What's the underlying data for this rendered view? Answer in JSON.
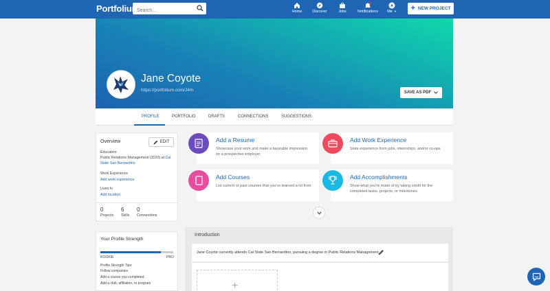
{
  "nav": {
    "logo": "Portfolium",
    "search_placeholder": "Search...",
    "items": [
      {
        "label": "Home",
        "icon": "home-icon"
      },
      {
        "label": "Discover",
        "icon": "compass-icon"
      },
      {
        "label": "Jobs",
        "icon": "briefcase-icon"
      },
      {
        "label": "Notifications",
        "icon": "bell-icon"
      },
      {
        "label": "Me",
        "icon": "avatar-icon"
      }
    ],
    "new_project": "NEW PROJECT"
  },
  "profile": {
    "name": "Jane Coyote",
    "url": "https://portfolium.com/J4m",
    "save_pdf": "SAVE AS PDF"
  },
  "tabs": [
    "PROFILE",
    "PORTFOLIO",
    "DRAFTS",
    "CONNECTIONS",
    "SUGGESTIONS"
  ],
  "overview": {
    "title": "Overview",
    "edit": "EDIT",
    "education_label": "Education",
    "education_value": "Public Relations Management (2020) at",
    "education_school": "Cal State San Bernardino",
    "work_label": "Work Experience",
    "work_link": "Add work experience",
    "lives_label": "Lives In",
    "lives_link": "Add location",
    "stats": [
      {
        "num": "0",
        "label": "Projects"
      },
      {
        "num": "6",
        "label": "Skills"
      },
      {
        "num": "0",
        "label": "Connections"
      }
    ]
  },
  "strength": {
    "title": "Your Profile Strength",
    "progress": 0.83,
    "level_left": "ROOKIE",
    "level_right": "PRO",
    "tips_label": "Profile Strength Tips:",
    "tips": [
      "Follow companies",
      "Add a course you completed",
      "Add a club, affiliation, or program"
    ]
  },
  "add_cards": [
    {
      "title": "Add a Resume",
      "desc": "Showcase your work and make a favorable impression on a prospective employer.",
      "color": "#6c4bc1",
      "icon": "document-icon"
    },
    {
      "title": "Add Work Experience",
      "desc": "State experience from jobs, internships, and/or co-ops",
      "color": "#ee4b5e",
      "icon": "briefcase-icon"
    },
    {
      "title": "Add Courses",
      "desc": "List current or past courses that you've learned a lot from",
      "color": "#e84c9e",
      "icon": "notebook-icon"
    },
    {
      "title": "Add Accomplishments",
      "desc": "Show what you're made of by taking credit for the completed tasks, projects, or milestones",
      "color": "#19b9e3",
      "icon": "trophy-icon"
    }
  ],
  "intro": {
    "title": "Introduction",
    "text": "Jane Coyote currently attends Cal State San Bernardino, pursuing a degree in Public Relations Management"
  }
}
